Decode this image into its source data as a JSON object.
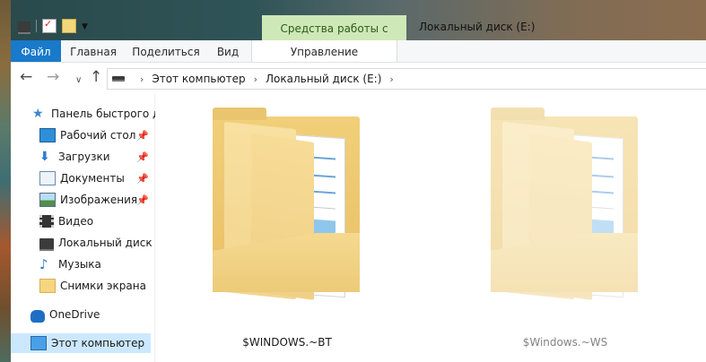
{
  "window": {
    "title": "Локальный диск (E:)",
    "context_tab_group": "Средства работы с дисками"
  },
  "quick_access_toolbar": {
    "icons": [
      "drive-icon",
      "properties-icon",
      "new-folder-icon",
      "customize-dropdown-icon"
    ]
  },
  "ribbon": {
    "tabs": [
      {
        "label": "Файл",
        "active": true
      },
      {
        "label": "Главная"
      },
      {
        "label": "Поделиться"
      },
      {
        "label": "Вид"
      },
      {
        "label": "Управление"
      }
    ]
  },
  "address_bar": {
    "path": [
      "Этот компьютер",
      "Локальный диск (E:)"
    ]
  },
  "navigation_pane": {
    "items": [
      {
        "label": "Панель быстрого доступа",
        "icon": "star-icon",
        "pinned": false
      },
      {
        "label": "Рабочий стол",
        "icon": "desktop-icon",
        "pinned": true
      },
      {
        "label": "Загрузки",
        "icon": "download-icon",
        "pinned": true
      },
      {
        "label": "Документы",
        "icon": "documents-icon",
        "pinned": true
      },
      {
        "label": "Изображения",
        "icon": "pictures-icon",
        "pinned": true
      },
      {
        "label": "Видео",
        "icon": "video-icon",
        "pinned": false
      },
      {
        "label": "Локальный диск (E:)",
        "icon": "drive-icon",
        "pinned": false
      },
      {
        "label": "Музыка",
        "icon": "music-icon",
        "pinned": false
      },
      {
        "label": "Снимки экрана",
        "icon": "folder-icon",
        "pinned": false
      },
      {
        "label": "OneDrive",
        "icon": "onedrive-icon",
        "pinned": false
      },
      {
        "label": "Этот компьютер",
        "icon": "computer-icon",
        "pinned": false,
        "selected": true
      }
    ]
  },
  "files": [
    {
      "name": "$WINDOWS.~BT",
      "type": "folder",
      "hidden": false
    },
    {
      "name": "$Windows.~WS",
      "type": "folder",
      "hidden": true
    }
  ],
  "colors": {
    "file_tab": "#1979ca",
    "context_tab": "#cfe8b8",
    "selection": "#cce8ff",
    "folder": "#f1cf79"
  }
}
